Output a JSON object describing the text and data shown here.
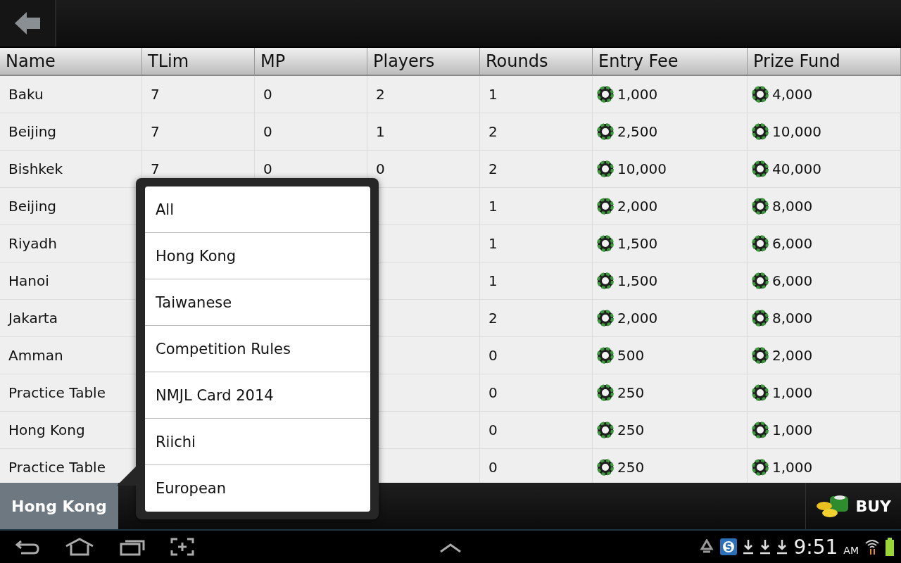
{
  "table": {
    "columns": [
      "Name",
      "TLim",
      "MP",
      "Players",
      "Rounds",
      "Entry Fee",
      "Prize Fund"
    ],
    "rows": [
      {
        "name": "Baku",
        "tlim": "7",
        "mp": "0",
        "players": "2",
        "rounds": "1",
        "entry_fee": "1,000",
        "prize_fund": "4,000"
      },
      {
        "name": "Beijing",
        "tlim": "7",
        "mp": "0",
        "players": "1",
        "rounds": "2",
        "entry_fee": "2,500",
        "prize_fund": "10,000"
      },
      {
        "name": "Bishkek",
        "tlim": "7",
        "mp": "0",
        "players": "0",
        "rounds": "2",
        "entry_fee": "10,000",
        "prize_fund": "40,000"
      },
      {
        "name": "Beijing",
        "rounds": "1",
        "entry_fee": "2,000",
        "prize_fund": "8,000"
      },
      {
        "name": "Riyadh",
        "rounds": "1",
        "entry_fee": "1,500",
        "prize_fund": "6,000"
      },
      {
        "name": "Hanoi",
        "rounds": "1",
        "entry_fee": "1,500",
        "prize_fund": "6,000"
      },
      {
        "name": "Jakarta",
        "rounds": "2",
        "entry_fee": "2,000",
        "prize_fund": "8,000"
      },
      {
        "name": "Amman",
        "rounds": "0",
        "entry_fee": "500",
        "prize_fund": "2,000"
      },
      {
        "name": "Practice Table",
        "rounds": "0",
        "entry_fee": "250",
        "prize_fund": "1,000"
      },
      {
        "name": "Hong Kong",
        "rounds": "0",
        "entry_fee": "250",
        "prize_fund": "1,000"
      },
      {
        "name": "Practice Table",
        "rounds": "0",
        "entry_fee": "250",
        "prize_fund": "1,000"
      }
    ]
  },
  "popup_menu": {
    "items": [
      "All",
      "Hong Kong",
      "Taiwanese",
      "Competition Rules",
      "NMJL Card 2014",
      "Riichi",
      "European"
    ]
  },
  "bottom_bar": {
    "tabs": [
      {
        "label": "Hong Kong",
        "selected": true
      }
    ],
    "buy_button": "BUY"
  },
  "status_bar": {
    "time": "9:51",
    "am_pm": "AM"
  }
}
